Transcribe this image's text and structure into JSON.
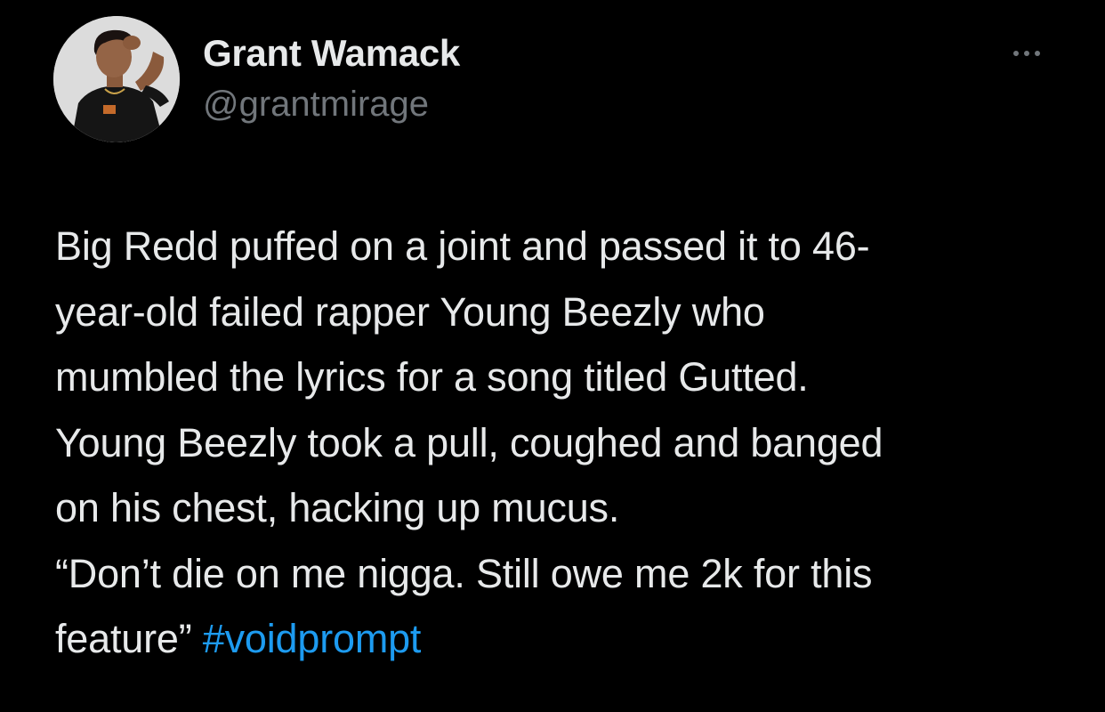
{
  "author": {
    "display_name": "Grant Wamack",
    "handle": "@grantmirage",
    "avatar_icon": "profile-photo"
  },
  "menu": {
    "icon": "more-horizontal-icon"
  },
  "tweet": {
    "lines": [
      "Big Redd puffed on a joint and passed it to 46-",
      "year-old failed rapper Young Beezly who",
      "mumbled the lyrics for a song titled Gutted.",
      "Young Beezly took a pull, coughed and banged",
      "on his chest, hacking up mucus.",
      "“Don’t die on me nigga. Still owe me 2k for this"
    ],
    "last_line_text": "feature”",
    "hashtag": "#voidprompt"
  },
  "colors": {
    "background": "#000000",
    "text": "#e7e9ea",
    "secondary": "#71767b",
    "link": "#1d9bf0"
  }
}
